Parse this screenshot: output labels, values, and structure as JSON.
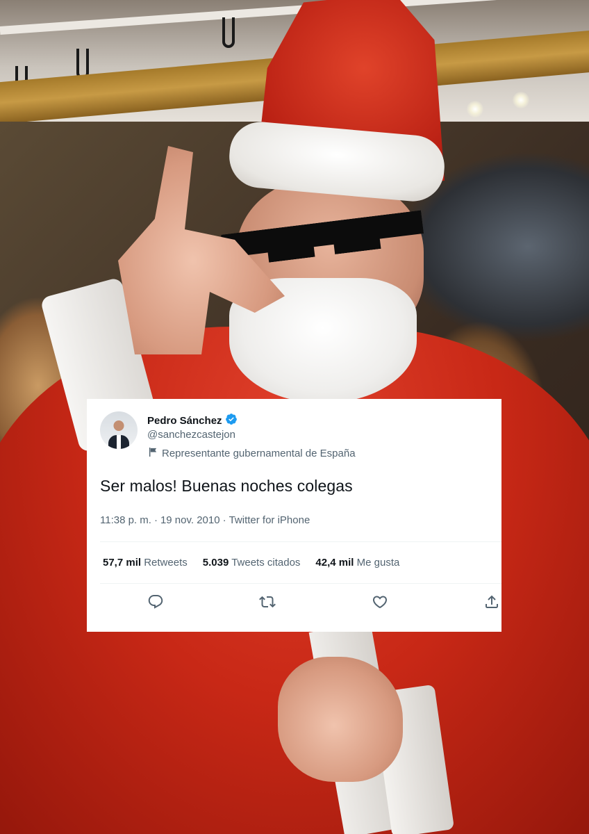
{
  "tweet": {
    "author_name": "Pedro Sánchez",
    "handle": "@sanchezcastejon",
    "account_label": "Representante gubernamental de España",
    "text": "Ser malos! Buenas noches colegas",
    "time": "11:38 p. m.",
    "separator": "·",
    "date": "19 nov. 2010",
    "source": "Twitter for iPhone",
    "stats": {
      "retweets_count": "57,7 mil",
      "retweets_label": "Retweets",
      "quotes_count": "5.039",
      "quotes_label": "Tweets citados",
      "likes_count": "42,4 mil",
      "likes_label": "Me gusta"
    },
    "actions": [
      "reply-icon",
      "retweet-icon",
      "like-icon",
      "share-icon"
    ]
  },
  "colors": {
    "verified": "#1d9bf0",
    "text_primary": "#0f1419",
    "text_secondary": "#536471",
    "santa_red": "#c82816"
  }
}
